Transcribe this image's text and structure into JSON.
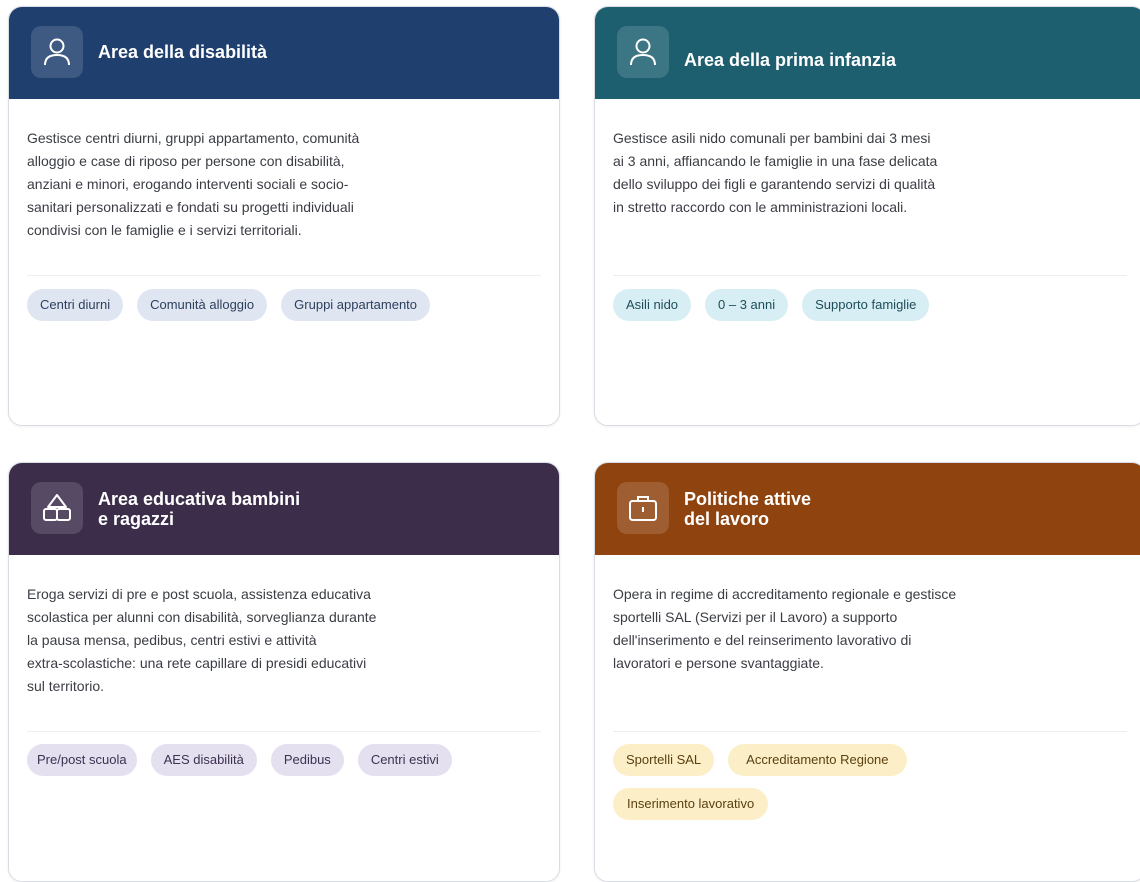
{
  "cards": [
    {
      "title": "Area della disabilità",
      "header_color": "#1f3f6e",
      "icon": "person-icon",
      "description": "Gestisce centri diurni, gruppi appartamento, comunità\nalloggio e case di riposo per persone con disabilità,\nanziani e minori, erogando interventi sociali e socio-\nsanitari personalizzati e fondati su progetti individuali\ncondivisi con le famiglie e i servizi territoriali.",
      "tag_bg": "#dfe6f1",
      "tag_fg": "#2c3f5c",
      "tags": [
        "Centri diurni",
        "Comunità alloggio",
        "Gruppi appartamento"
      ]
    },
    {
      "title": "Area della prima infanzia",
      "header_color": "#1d5f6f",
      "icon": "person-icon",
      "description": "Gestisce asili nido comunali per bambini dai 3 mesi\nai 3 anni, affiancando le famiglie in una fase delicata\ndello sviluppo dei figli e garantendo servizi di qualità\nin stretto raccordo con le amministrazioni locali.",
      "tag_bg": "#d7eef4",
      "tag_fg": "#1f4d59",
      "tags": [
        "Asili nido",
        "0 – 3 anni",
        "Supporto famiglie"
      ]
    },
    {
      "title": "Area educativa bambini\ne ragazzi",
      "header_color": "#3c2d4b",
      "icon": "building-blocks-icon",
      "description": "Eroga servizi di pre e post scuola, assistenza educativa\nscolastica per alunni con disabilità, sorveglianza durante\nla pausa mensa, pedibus, centri estivi e attività\nextra-scolastiche: una rete capillare di presidi educativi\nsul territorio.",
      "tag_bg": "#e5e0f0",
      "tag_fg": "#3d3152",
      "tags": [
        "Pre/post scuola",
        "AES disabilità",
        "Pedibus",
        "Centri estivi"
      ]
    },
    {
      "title": "Politiche attive\ndel lavoro",
      "header_color": "#8f4410",
      "icon": "briefcase-icon",
      "description": "Opera in regime di accreditamento regionale e gestisce\nsportelli SAL (Servizi per il Lavoro) a supporto\ndell'inserimento e del reinserimento lavorativo di\nlavoratori e persone svantaggiate.",
      "tag_bg": "#fcefc8",
      "tag_fg": "#5a3f10",
      "tags": [
        "Sportelli SAL",
        "Accreditamento Regione",
        "Inserimento lavorativo"
      ]
    }
  ]
}
